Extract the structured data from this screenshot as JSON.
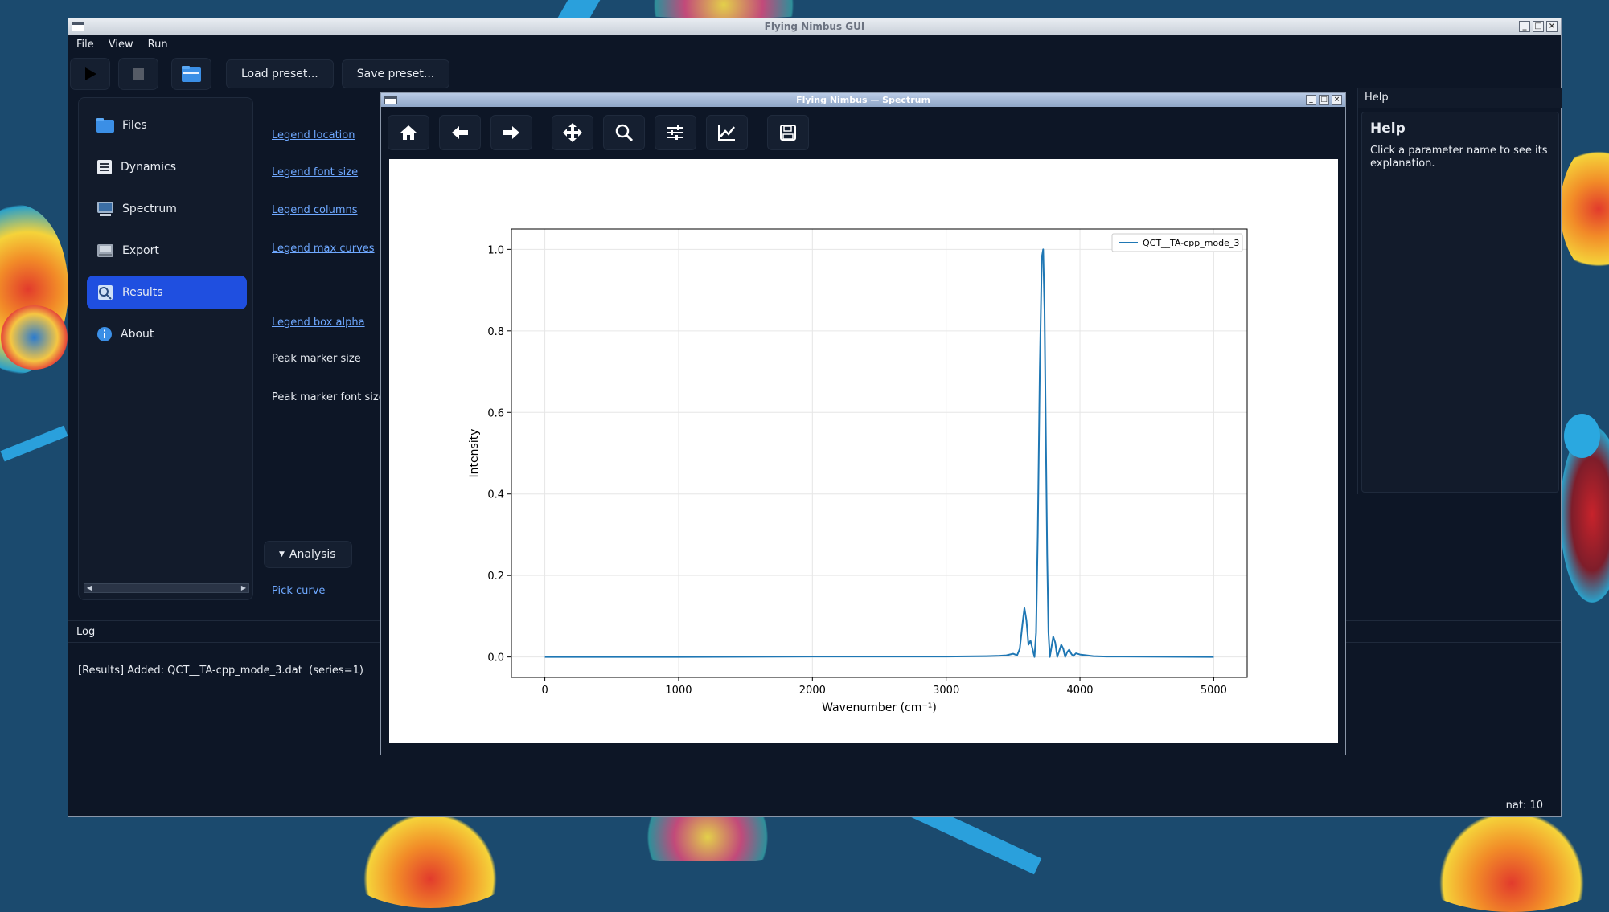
{
  "window": {
    "title": "Flying Nimbus GUI"
  },
  "menu": [
    "File",
    "View",
    "Run"
  ],
  "toolbar": {
    "run_icon": "play-icon",
    "stop_icon": "stop-icon",
    "open_icon": "folder-icon",
    "load_label": "Load preset...",
    "save_label": "Save preset..."
  },
  "sidebar": {
    "items": [
      {
        "label": "Files",
        "icon": "folder-icon"
      },
      {
        "label": "Dynamics",
        "icon": "document-icon"
      },
      {
        "label": "Spectrum",
        "icon": "computer-icon"
      },
      {
        "label": "Export",
        "icon": "disk-icon"
      },
      {
        "label": "Results",
        "icon": "results-icon"
      },
      {
        "label": "About",
        "icon": "info-icon"
      }
    ],
    "active": "Results"
  },
  "params": {
    "legend_location": "Legend location",
    "legend_font_size": "Legend font size",
    "legend_columns": "Legend columns",
    "legend_max_curves": "Legend max curves",
    "legend_box_alpha": "Legend box alpha",
    "peak_marker_size": "Peak marker size",
    "peak_marker_font_size": "Peak marker font size",
    "analysis": "Analysis",
    "pick_curve": "Pick curve"
  },
  "help": {
    "panel_label": "Help",
    "title": "Help",
    "text": "Click a parameter name to see its explanation."
  },
  "log": {
    "label": "Log",
    "line": "[Results] Added: QCT__TA-cpp_mode_3.dat  (series=1)"
  },
  "status": {
    "text": "nat: 10"
  },
  "spectrum_window": {
    "title": "Flying Nimbus — Spectrum",
    "tools": [
      "home-icon",
      "back-icon",
      "forward-icon",
      "pan-icon",
      "zoom-icon",
      "configure-icon",
      "edit-axes-icon",
      "save-icon"
    ]
  },
  "chart_data": {
    "type": "line",
    "xlabel": "Wavenumber (cm⁻¹)",
    "ylabel": "Intensity",
    "xlim": [
      -250,
      5250
    ],
    "ylim": [
      -0.05,
      1.05
    ],
    "xticks": [
      0,
      1000,
      2000,
      3000,
      4000,
      5000
    ],
    "yticks": [
      0.0,
      0.2,
      0.4,
      0.6,
      0.8,
      1.0
    ],
    "grid": true,
    "legend_position": "top-right",
    "series": [
      {
        "name": "QCT__TA-cpp_mode_3",
        "color": "#1f77b4",
        "x": [
          0,
          1000,
          2000,
          3000,
          3300,
          3400,
          3450,
          3500,
          3530,
          3550,
          3570,
          3585,
          3600,
          3615,
          3630,
          3645,
          3660,
          3672,
          3685,
          3700,
          3715,
          3725,
          3735,
          3745,
          3755,
          3765,
          3775,
          3785,
          3800,
          3815,
          3830,
          3845,
          3860,
          3875,
          3890,
          3905,
          3920,
          3935,
          3950,
          3970,
          4000,
          4050,
          4100,
          4200,
          5000
        ],
        "y": [
          0.0,
          0.0,
          0.001,
          0.001,
          0.002,
          0.003,
          0.004,
          0.008,
          0.004,
          0.02,
          0.08,
          0.12,
          0.09,
          0.03,
          0.04,
          0.02,
          0.0,
          0.06,
          0.3,
          0.7,
          0.98,
          1.0,
          0.85,
          0.55,
          0.25,
          0.06,
          0.0,
          0.02,
          0.05,
          0.035,
          0.0,
          0.015,
          0.03,
          0.02,
          0.0,
          0.012,
          0.018,
          0.008,
          0.002,
          0.009,
          0.006,
          0.004,
          0.002,
          0.001,
          0.0
        ]
      }
    ]
  }
}
